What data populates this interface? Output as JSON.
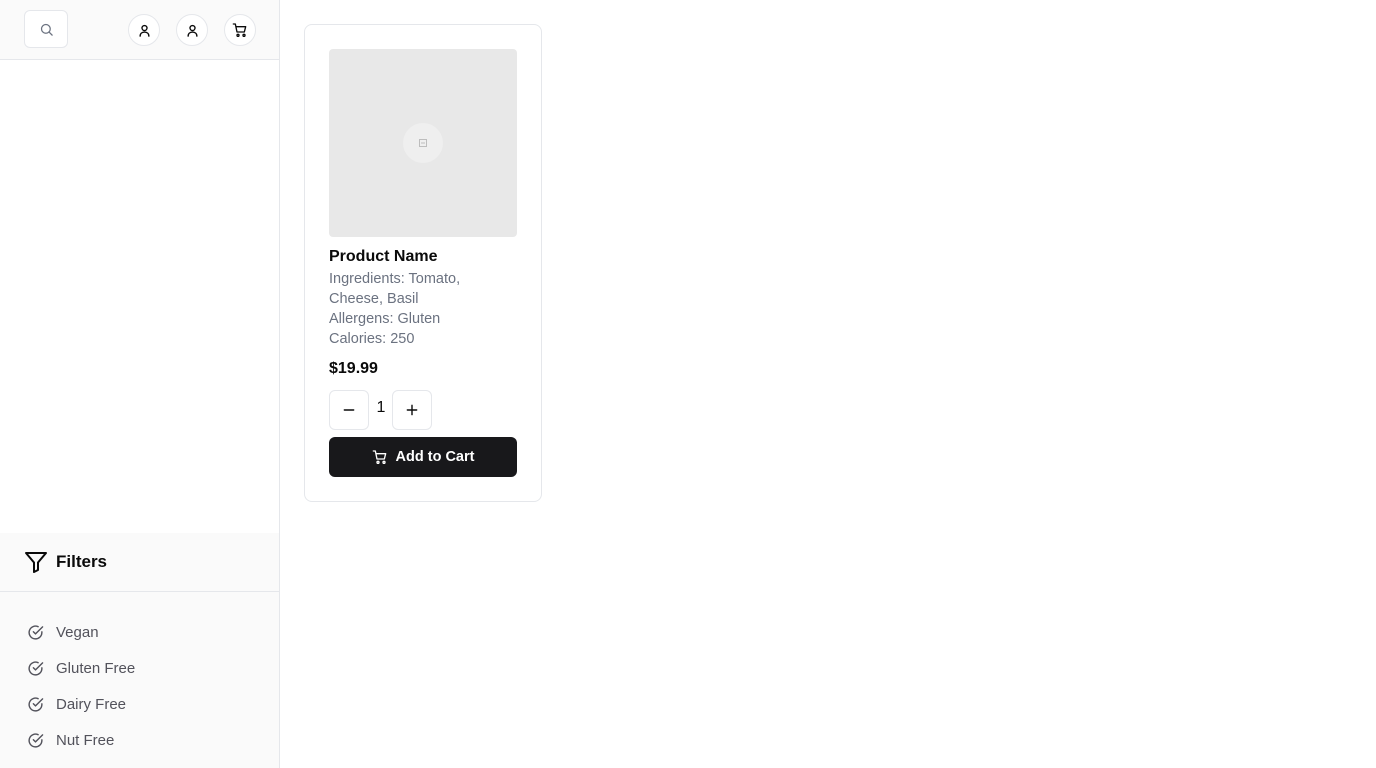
{
  "header": {
    "icons": [
      "search-icon",
      "user-icon",
      "user-icon",
      "cart-icon"
    ]
  },
  "filters": {
    "title": "Filters",
    "items": [
      {
        "label": "Vegan"
      },
      {
        "label": "Gluten Free"
      },
      {
        "label": "Dairy Free"
      },
      {
        "label": "Nut Free"
      }
    ]
  },
  "product": {
    "name": "Product Name",
    "ingredients": "Ingredients: Tomato, Cheese, Basil",
    "allergens": "Allergens: Gluten",
    "calories": "Calories: 250",
    "price": "$19.99",
    "quantity": "1",
    "add_to_cart_label": "Add to Cart"
  },
  "colors": {
    "primary_button": "#18181b",
    "muted_text": "#6b7280",
    "panel_bg": "#fafafa",
    "border": "#e5e7eb"
  }
}
